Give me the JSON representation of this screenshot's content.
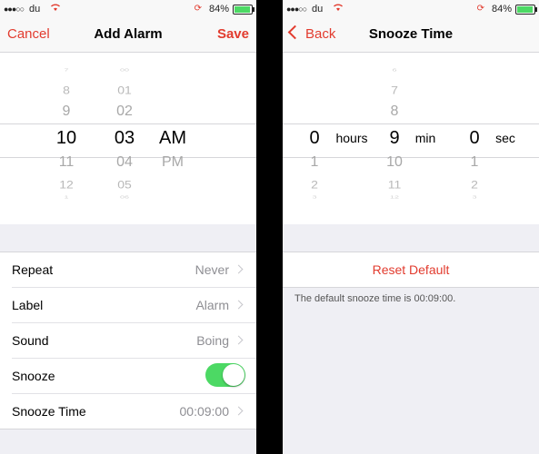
{
  "status_bar": {
    "signal": "●●●○○",
    "carrier": "du",
    "wifi_icon": "wifi-icon",
    "battery_percent": "84%"
  },
  "add_alarm": {
    "nav": {
      "cancel_label": "Cancel",
      "title": "Add Alarm",
      "save_label": "Save"
    },
    "picker": {
      "hours_above": [
        "7",
        "8",
        "9"
      ],
      "hour_selected": "10",
      "hours_below": [
        "11",
        "12",
        "1"
      ],
      "minutes_above": [
        "00",
        "01",
        "02"
      ],
      "minute_selected": "03",
      "minutes_below": [
        "04",
        "05",
        "06"
      ],
      "period_selected": "AM",
      "period_below": "PM"
    },
    "settings": [
      {
        "label": "Repeat",
        "value": "Never"
      },
      {
        "label": "Label",
        "value": "Alarm"
      },
      {
        "label": "Sound",
        "value": "Boing"
      },
      {
        "label": "Snooze",
        "toggle": true
      },
      {
        "label": "Snooze Time",
        "value": "00:09:00"
      }
    ]
  },
  "snooze_time": {
    "nav": {
      "back_label": "Back",
      "title": "Snooze Time"
    },
    "picker": {
      "hour_value": "0",
      "hour_unit": "hours",
      "hours_below": [
        "1",
        "2",
        "3"
      ],
      "minutes_above": [
        "6",
        "7",
        "8"
      ],
      "minute_value": "9",
      "minute_unit": "min",
      "minutes_below": [
        "10",
        "11",
        "12"
      ],
      "second_value": "0",
      "second_unit": "sec",
      "seconds_below": [
        "1",
        "2",
        "3"
      ]
    },
    "reset_label": "Reset Default",
    "footnote": "The default snooze time is 00:09:00."
  },
  "colors": {
    "accent": "#e23b2e",
    "toggle_on": "#4cd964",
    "background": "#efeff4"
  }
}
